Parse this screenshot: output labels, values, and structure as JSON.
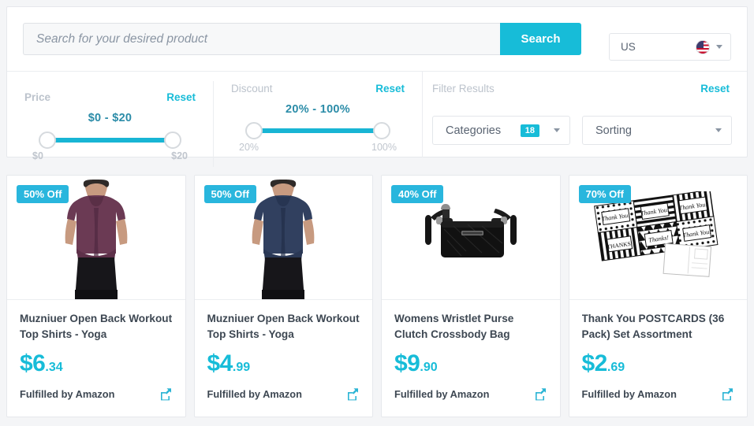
{
  "search": {
    "placeholder": "Search for your desired product",
    "value": "",
    "button_label": "Search"
  },
  "country": {
    "code": "US",
    "icon": "us-flag-icon",
    "caret": "chevron-down-icon"
  },
  "filters": {
    "price": {
      "label": "Price",
      "reset_label": "Reset",
      "range_text": "$0 - $20",
      "min_label": "$0",
      "max_label": "$20"
    },
    "discount": {
      "label": "Discount",
      "reset_label": "Reset",
      "range_text": "20% - 100%",
      "min_label": "20%",
      "max_label": "100%"
    },
    "results": {
      "label": "Filter Results",
      "reset_label": "Reset",
      "categories": {
        "label": "Categories",
        "count": "18"
      },
      "sorting": {
        "label": "Sorting"
      }
    }
  },
  "colors": {
    "accent": "#17bcd8",
    "badge": "#29b6dd",
    "range_text": "#2b8ca8",
    "title": "#3d4752",
    "muted": "#bcc3cc",
    "page_bg": "#f4f5f7"
  },
  "products": [
    {
      "discount_badge": "50% Off",
      "title": "Muzniuer Open Back Workout Top Shirts - Yoga",
      "price_main": "$6",
      "price_cents": ".34",
      "fulfilled": "Fulfilled by Amazon",
      "share_icon": "share-external-link-icon",
      "art": "tank-top-purple"
    },
    {
      "discount_badge": "50% Off",
      "title": "Muzniuer Open Back Workout Top Shirts - Yoga",
      "price_main": "$4",
      "price_cents": ".99",
      "fulfilled": "Fulfilled by Amazon",
      "share_icon": "share-external-link-icon",
      "art": "tank-top-navy"
    },
    {
      "discount_badge": "40% Off",
      "title": "Womens Wristlet Purse Clutch Crossbody Bag",
      "price_main": "$9",
      "price_cents": ".90",
      "fulfilled": "Fulfilled by Amazon",
      "share_icon": "share-external-link-icon",
      "art": "crossbody-bag-black"
    },
    {
      "discount_badge": "70% Off",
      "title": "Thank You POSTCARDS (36 Pack) Set Assortment",
      "price_main": "$2",
      "price_cents": ".69",
      "fulfilled": "Fulfilled by Amazon",
      "share_icon": "share-external-link-icon",
      "art": "postcards-bw"
    }
  ]
}
